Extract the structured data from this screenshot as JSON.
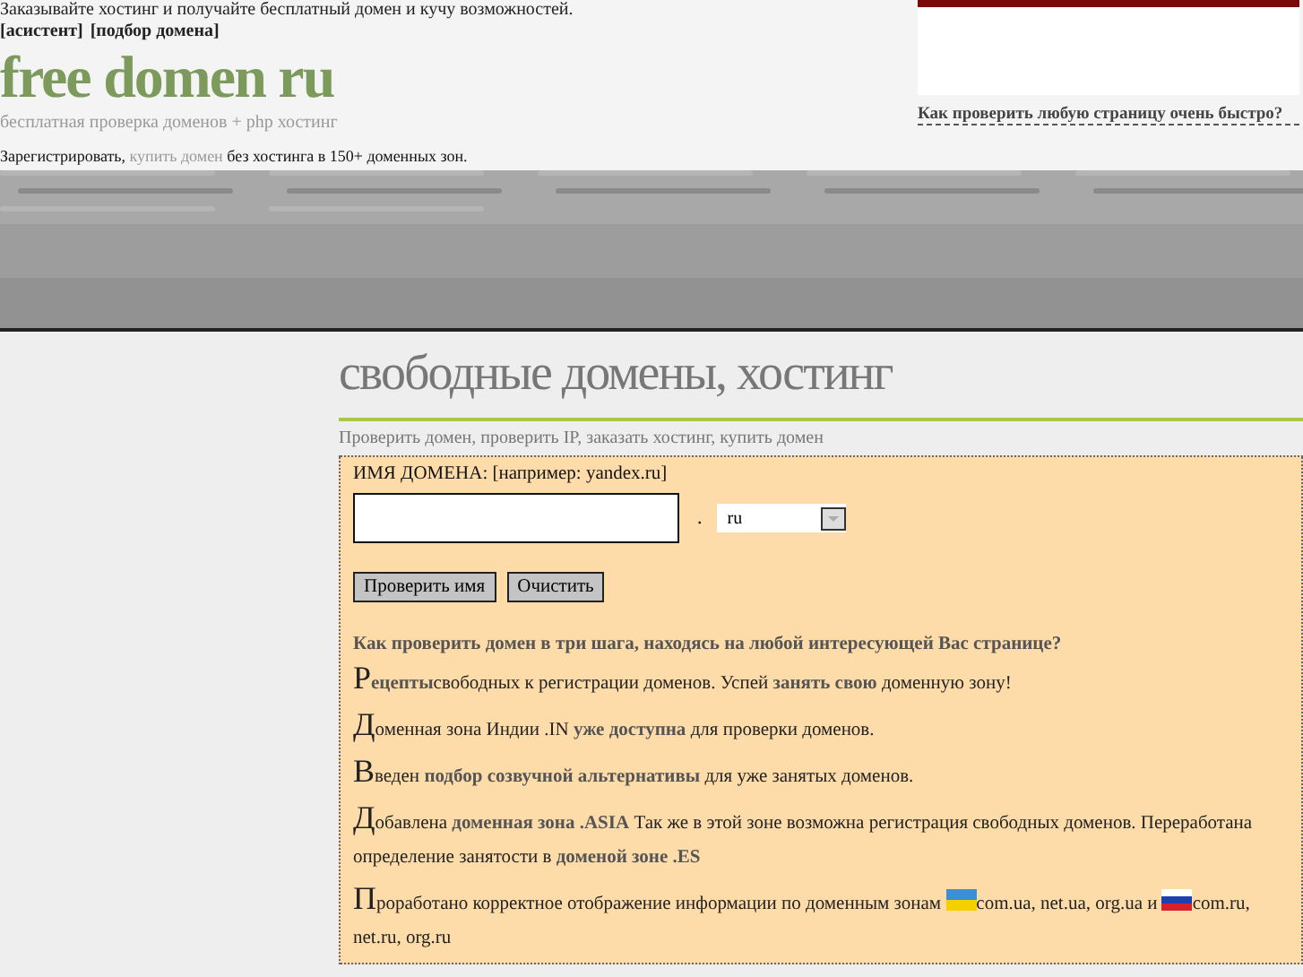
{
  "header": {
    "tagline": "Заказывайте хостинг и получайте бесплатный домен и кучу возможностей.",
    "top_links": [
      "[асистент]",
      "[подбор домена]"
    ],
    "logo": "free domen ru",
    "subtitle": "бесплатная проверка доменов + php хостинг",
    "register_line": "Зарегистрировать, **купить домен** без хостинга в 150+ доменных зон.",
    "side_link": "Как проверить любую страницу очень быстро?"
  },
  "main": {
    "title": "свободные домены, хостинг",
    "subtitle": "Проверить домен, проверить IP, заказать хостинг, купить домен",
    "form": {
      "label": "ИМЯ ДОМЕНА: [например: yandex.ru]",
      "dot": ".",
      "zone": "ru",
      "buttons": [
        "Проверить имя",
        "Очистить"
      ]
    },
    "howto": "Как проверить домен в три шага, находясь на любой интересующей Вас странице?",
    "news": [
      {
        "initial": "Р",
        "parts": [
          {
            "kind": "text",
            "text": "**ецепты**свободных к регистрации доменов. Успей **занять свою** доменную зону!"
          }
        ]
      },
      {
        "initial": "Д",
        "parts": [
          {
            "kind": "text",
            "text": "оменная зона Индии .IN **уже доступна** для проверки доменов."
          }
        ]
      },
      {
        "initial": "В",
        "parts": [
          {
            "kind": "text",
            "text": "веден **подбор созвучной альтернативы** для уже занятых доменов."
          }
        ]
      },
      {
        "initial": "Д",
        "parts": [
          {
            "kind": "text",
            "text": "обавлена **доменная зона .ASIA** Так же в этой зоне возможна регистрация свободных доменов. Переработана определение занятости в **доменой зоне .ES**"
          }
        ]
      },
      {
        "initial": "П",
        "parts": [
          {
            "kind": "text",
            "text": "роработано корректное отображение информации по доменным зонам "
          },
          {
            "kind": "uaflag"
          },
          {
            "kind": "text",
            "text": "com.ua, net.ua, org.ua и "
          },
          {
            "kind": "ruflag"
          },
          {
            "kind": "text",
            "text": "com.ru,"
          },
          {
            "kind": "text",
            "text": "net.ru, org.ru"
          }
        ]
      }
    ]
  }
}
